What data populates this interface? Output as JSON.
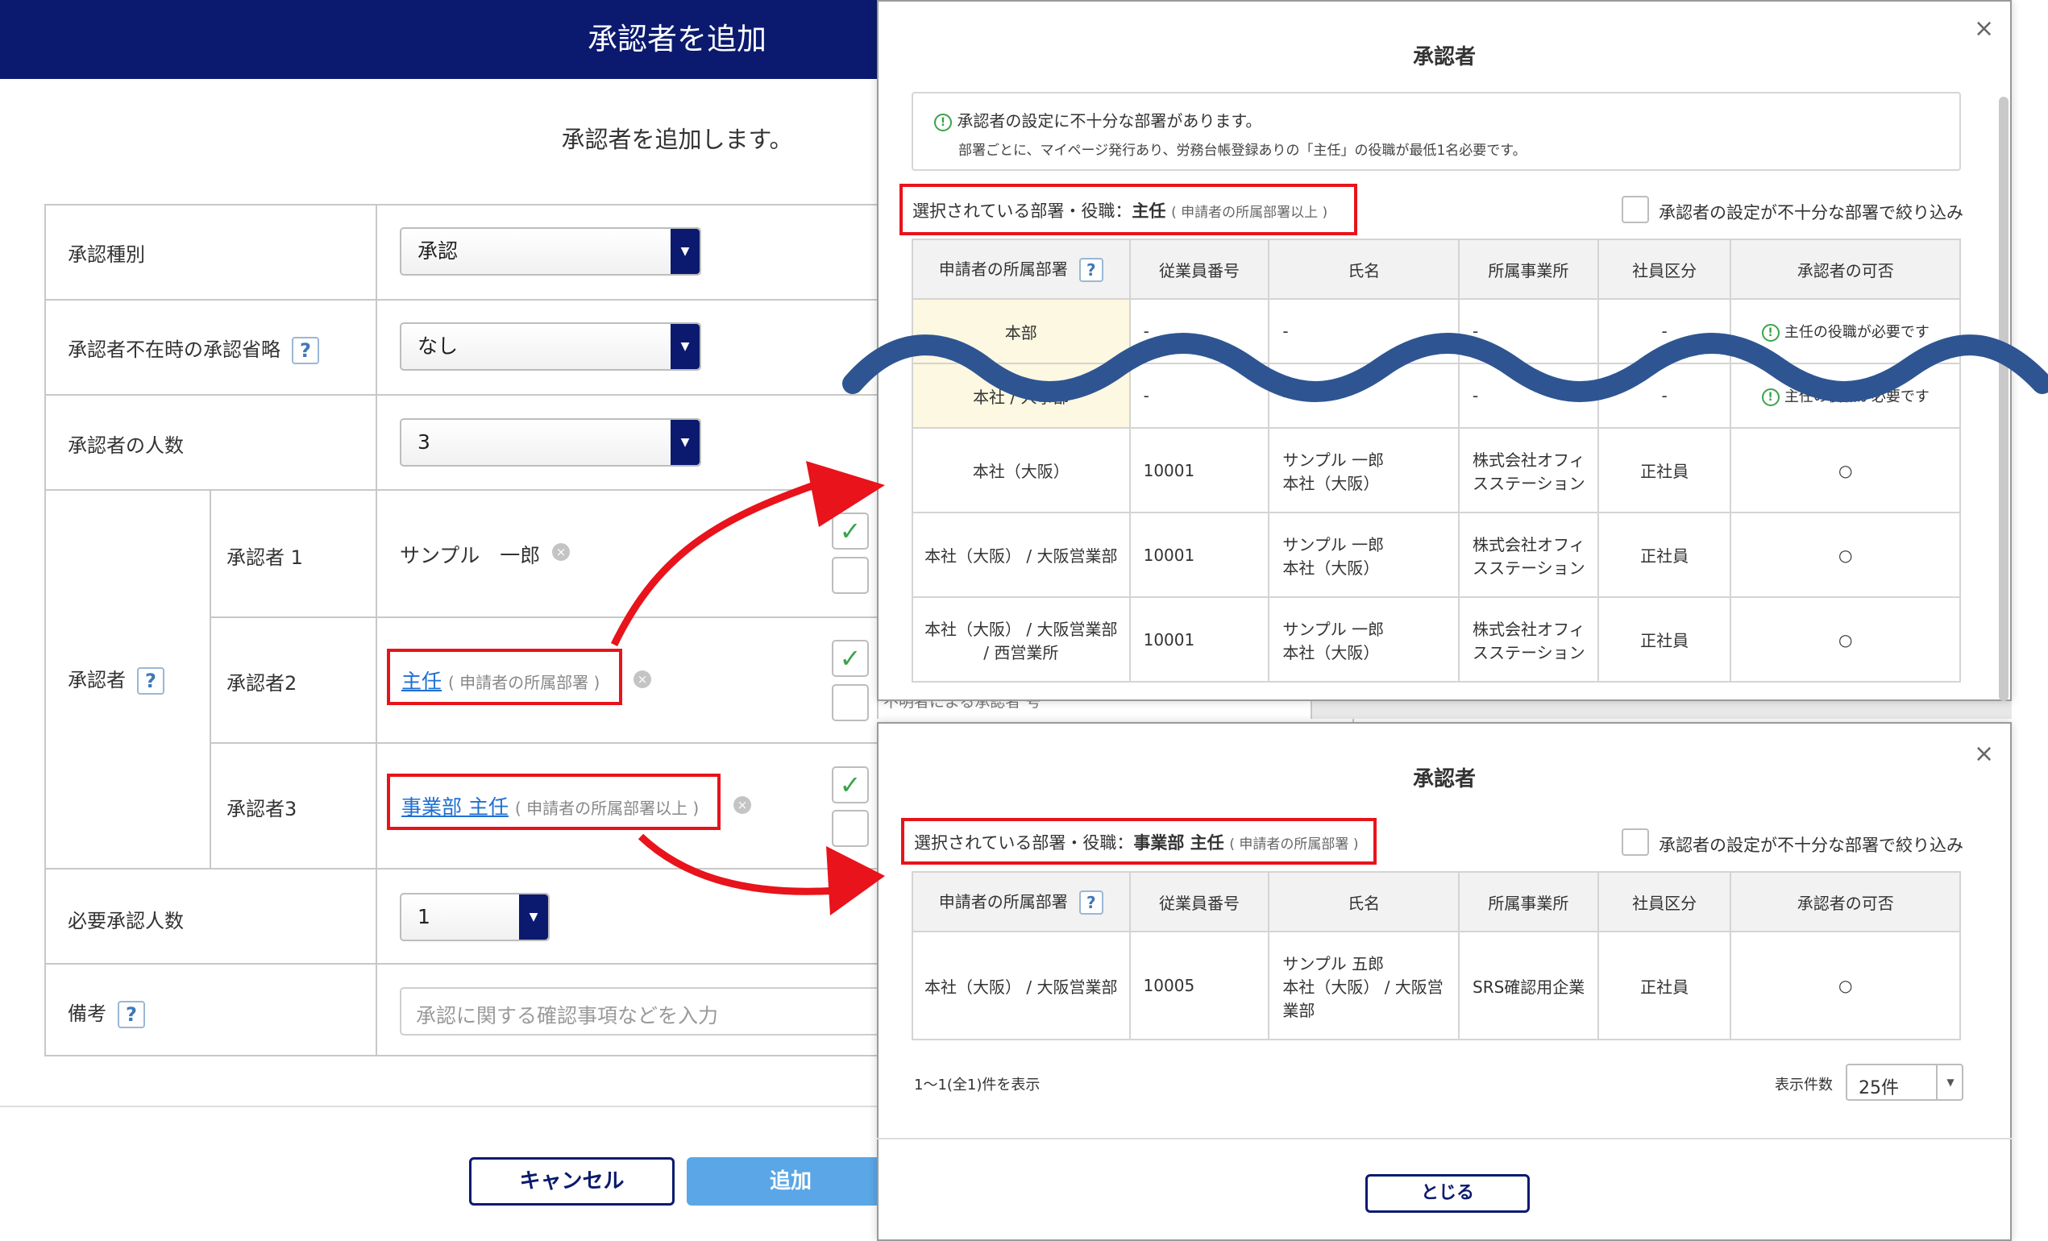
{
  "base": {
    "title": "承認者を追加",
    "intro": "承認者を追加します。",
    "rows": {
      "type_label": "承認種別",
      "type_value": "承認",
      "omit_label": "承認者不在時の承認省略",
      "omit_value": "なし",
      "count_label": "承認者の人数",
      "count_value": "3",
      "approver_label": "承認者",
      "approver1_label": "承認者 1",
      "approver1_value": "サンプル　一郎",
      "approver2_label": "承認者2",
      "approver2_link": "主任",
      "approver2_note": "( 申請者の所属部署 )",
      "approver3_label": "承認者3",
      "approver3_link": "事業部 主任",
      "approver3_note": "( 申請者の所属部署以上 )",
      "required_label": "必要承認人数",
      "required_value": "1",
      "remarks_label": "備考",
      "remarks_placeholder": "承認に関する確認事項などを入力"
    },
    "cancel_label": "キャンセル",
    "add_label": "追加",
    "hidden_text": "不明者による承認者 号"
  },
  "icons": {
    "help": "?",
    "dropdown": "▼",
    "clear": "×",
    "check": "✓",
    "info": "!",
    "close": "×",
    "circle": "○"
  },
  "modal1": {
    "title": "承認者",
    "notice_line1": "承認者の設定に不十分な部署があります。",
    "notice_line2": "部署ごとに、マイページ発行あり、労務台帳登録ありの「主任」の役職が最低1名必要です。",
    "selected_prefix": "選択されている部署・役職：",
    "selected_role": "主任",
    "selected_note": "( 申請者の所属部署以上 )",
    "filter_label": "承認者の設定が不十分な部署で絞り込み",
    "headers": [
      "申請者の所属部署",
      "従業員番号",
      "氏名",
      "所属事業所",
      "社員区分",
      "承認者の可否"
    ],
    "rows": [
      {
        "dept": "本部",
        "no": "-",
        "name1": "-",
        "name2": "",
        "office1": "-",
        "office2": "",
        "type": "-",
        "status": "主任の役職が必要です",
        "warn": true
      },
      {
        "dept": "本社 / 人事部",
        "no": "-",
        "name1": "-",
        "name2": "",
        "office1": "-",
        "office2": "",
        "type": "-",
        "status": "主任の役職が必要です",
        "warn": true
      },
      {
        "dept": "本社（大阪）",
        "no": "10001",
        "name1": "サンプル 一郎",
        "name2": "本社（大阪）",
        "office1": "株式会社オフィ",
        "office2": "スステーション",
        "type": "正社員",
        "status": "○",
        "warn": false
      },
      {
        "dept": "本社（大阪） / 大阪営業部",
        "no": "10001",
        "name1": "サンプル 一郎",
        "name2": "本社（大阪）",
        "office1": "株式会社オフィ",
        "office2": "スステーション",
        "type": "正社員",
        "status": "○",
        "warn": false
      },
      {
        "dept": "本社（大阪） / 大阪営業部 / 西営業所",
        "no": "10001",
        "name1": "サンプル 一郎",
        "name2": "本社（大阪）",
        "office1": "株式会社オフィ",
        "office2": "スステーション",
        "type": "正社員",
        "status": "○",
        "warn": false
      }
    ]
  },
  "modal2": {
    "title": "承認者",
    "selected_prefix": "選択されている部署・役職：",
    "selected_role": "事業部 主任",
    "selected_note": "( 申請者の所属部署 )",
    "filter_label": "承認者の設定が不十分な部署で絞り込み",
    "headers": [
      "申請者の所属部署",
      "従業員番号",
      "氏名",
      "所属事業所",
      "社員区分",
      "承認者の可否"
    ],
    "row": {
      "dept": "本社（大阪） / 大阪営業部",
      "no": "10005",
      "name1": "サンプル 五郎",
      "name2": "本社（大阪） / 大阪営",
      "name3": "業部",
      "office": "SRS確認用企業",
      "type": "正社員",
      "status": "○"
    },
    "count_text": "1〜1(全1)件を表示",
    "per_page_label": "表示件数",
    "per_page_value": "25件",
    "close_label": "とじる"
  },
  "colors": {
    "navy": "#0b1a6e",
    "red": "#e8131b",
    "link": "#1f6fd1",
    "wave": "#2e5592",
    "green": "#3aa34b",
    "add_button": "#5aa6e6",
    "highlight": "#fdf8e1"
  }
}
